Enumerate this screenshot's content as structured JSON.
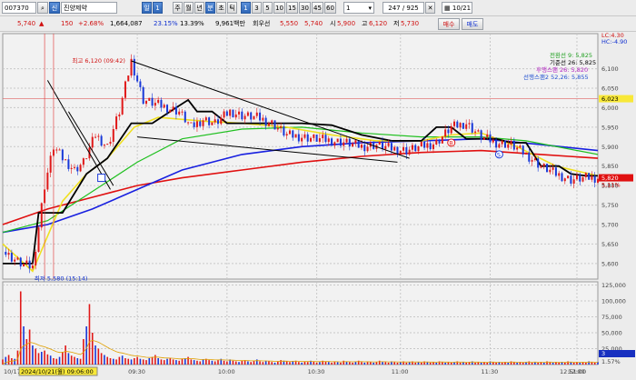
{
  "toolbar": {
    "code": "007370",
    "search_icon": "search-icon",
    "market_badge": "신",
    "stock_name": "진양제약",
    "period_buttons": [
      "일",
      "1"
    ],
    "period_units": [
      "주",
      "월",
      "년",
      "분",
      "초",
      "틱"
    ],
    "number_buttons": [
      "1",
      "3",
      "5",
      "10",
      "15",
      "30",
      "45",
      "60"
    ],
    "dropdown_value": "1",
    "page_counter": "247 / 925",
    "date_value": "10/21",
    "calendar_icon": "calendar-icon"
  },
  "quote": {
    "price": "5,740",
    "change_icon": "up-triangle-icon",
    "change": "150",
    "change_pct": "+2.68%",
    "volume": "1,664,087",
    "vol_ratio": "23.15%",
    "turnover": "13.39%",
    "amount": "9,961백만",
    "base_label": "회우선",
    "base_value": "5,550",
    "curr_value": "5,740",
    "open_label": "시",
    "open_value": "5,900",
    "high_label": "고",
    "high_value": "6,120",
    "low_label": "저",
    "low_value": "5,730",
    "buy_label": "매수",
    "sell_label": "매도"
  },
  "chart_data": {
    "type": "line",
    "session_label": "10/17",
    "x_date_label": "2024/10/21(월) 09:06:00",
    "x_ticks": [
      "09:30",
      "10:00",
      "10:30",
      "11:00",
      "11:30",
      "12:00",
      "12:30",
      "12:51:00"
    ],
    "price_ylim": [
      5560,
      6190
    ],
    "price_ticks": [
      "6,100",
      "6,050",
      "6,000",
      "5,950",
      "5,900",
      "5,850",
      "5,800",
      "5,750",
      "5,700",
      "5,650",
      "5,600"
    ],
    "price_top_labels": [
      "LC:4.30",
      "HC:-4.90"
    ],
    "current_price_tag": "5,820",
    "current_price": 5820,
    "sub_tag": "5,11%",
    "ref_price_tag": "6,023",
    "ref_price": 6023,
    "high_annotation": "최고 6,120 (09:42)",
    "low_annotation": "최저 5,580 (15:14)",
    "legend": [
      "전환선 9: 5,825",
      "기준선 26: 5,825",
      "후행스팬 26: 5,820",
      "선행스팬2 52,26: 5,855"
    ],
    "volume_ylim": [
      0,
      130000
    ],
    "volume_ticks": [
      "125,000",
      "100,000",
      "75,000",
      "50,000",
      "25,000",
      "3",
      "1.57%"
    ],
    "markers": [
      "B",
      "S"
    ],
    "series": [
      {
        "name": "price",
        "x": [
          0,
          6,
          10,
          14,
          17,
          20,
          24,
          27,
          31,
          35,
          39,
          43,
          47,
          51,
          55,
          59,
          63,
          67,
          71,
          76,
          80,
          85,
          90,
          95,
          100,
          105,
          110,
          115,
          120,
          125,
          130,
          135,
          140,
          145,
          150,
          155,
          160,
          165,
          170,
          175,
          180,
          185,
          190,
          195,
          199
        ],
        "values": [
          5630,
          5600,
          5590,
          5800,
          5900,
          5870,
          5840,
          5860,
          5930,
          5900,
          5990,
          6120,
          6020,
          6010,
          6000,
          5990,
          5950,
          5970,
          5960,
          5990,
          5980,
          5975,
          5960,
          5930,
          5925,
          5920,
          5915,
          5910,
          5900,
          5905,
          5895,
          5890,
          5900,
          5910,
          5950,
          5960,
          5925,
          5910,
          5905,
          5880,
          5850,
          5830,
          5815,
          5820,
          5820
        ]
      },
      {
        "name": "전환선",
        "x": [
          0,
          10,
          20,
          28,
          35,
          44,
          52,
          60,
          68,
          80,
          95,
          110,
          125,
          140,
          150,
          160,
          172,
          185,
          199
        ],
        "values": [
          5650,
          5580,
          5760,
          5830,
          5870,
          5950,
          5975,
          5970,
          5965,
          5960,
          5950,
          5930,
          5915,
          5915,
          5930,
          5935,
          5900,
          5850,
          5825
        ]
      },
      {
        "name": "기준선",
        "x": [
          0,
          10,
          12,
          20,
          28,
          35,
          43,
          50,
          58,
          62,
          65,
          70,
          75,
          80,
          90,
          100,
          110,
          120,
          130,
          140,
          145,
          150,
          155,
          160,
          165,
          170,
          175,
          180,
          186,
          190,
          195,
          199
        ],
        "values": [
          5600,
          5600,
          5730,
          5730,
          5830,
          5870,
          5960,
          5960,
          6000,
          6020,
          5990,
          5990,
          5960,
          5960,
          5960,
          5960,
          5955,
          5930,
          5915,
          5915,
          5950,
          5950,
          5920,
          5920,
          5920,
          5910,
          5910,
          5850,
          5850,
          5830,
          5825,
          5825
        ]
      },
      {
        "name": "후행스팬",
        "x": [
          0,
          15,
          25,
          35,
          45,
          60,
          80,
          100,
          120,
          140,
          160,
          175,
          199
        ],
        "values": [
          5680,
          5710,
          5760,
          5810,
          5860,
          5920,
          5945,
          5950,
          5935,
          5925,
          5925,
          5915,
          5880
        ]
      },
      {
        "name": "선행스팬2",
        "x": [
          0,
          15,
          30,
          45,
          60,
          80,
          100,
          120,
          140,
          160,
          180,
          199
        ],
        "values": [
          5680,
          5700,
          5740,
          5790,
          5840,
          5880,
          5900,
          5910,
          5915,
          5920,
          5905,
          5890
        ]
      },
      {
        "name": "선행스팬1",
        "x": [
          0,
          15,
          30,
          45,
          60,
          80,
          100,
          120,
          140,
          160,
          180,
          199
        ],
        "values": [
          5700,
          5740,
          5770,
          5800,
          5820,
          5840,
          5860,
          5875,
          5885,
          5890,
          5880,
          5870
        ]
      }
    ],
    "trendlines": [
      {
        "x": [
          43,
          136
        ],
        "values": [
          6120,
          5870
        ]
      },
      {
        "x": [
          45,
          132
        ],
        "values": [
          5925,
          5860
        ]
      },
      {
        "x": [
          15,
          36
        ],
        "values": [
          6070,
          5790
        ]
      },
      {
        "x": [
          22,
          37
        ],
        "values": [
          5990,
          5800
        ]
      }
    ],
    "volume": [
      8,
      12,
      15,
      10,
      9,
      22,
      115,
      60,
      40,
      55,
      30,
      25,
      18,
      20,
      22,
      16,
      14,
      10,
      9,
      12,
      20,
      30,
      18,
      14,
      12,
      10,
      9,
      40,
      60,
      95,
      50,
      30,
      25,
      18,
      15,
      12,
      10,
      9,
      8,
      12,
      14,
      10,
      9,
      8,
      10,
      12,
      9,
      8,
      7,
      10,
      12,
      15,
      10,
      8,
      7,
      9,
      10,
      8,
      7,
      6,
      9,
      10,
      12,
      8,
      7,
      6,
      5,
      8,
      9,
      7,
      6,
      5,
      7,
      9,
      6,
      5,
      8,
      6,
      5,
      4,
      6,
      7,
      5,
      4,
      6,
      8,
      5,
      4,
      6,
      5,
      4,
      3,
      5,
      7,
      6,
      5,
      4,
      5,
      6,
      4,
      3,
      5,
      4,
      6,
      5,
      3,
      4,
      6,
      5,
      4,
      3,
      5,
      4,
      3,
      6,
      5,
      4,
      3,
      5,
      6,
      4,
      3,
      5,
      4,
      3,
      4,
      6,
      5,
      4,
      3,
      5,
      4,
      3,
      4,
      5,
      3,
      4,
      5,
      3,
      4,
      3,
      5,
      4,
      3,
      4,
      3,
      5,
      4,
      3,
      4,
      3,
      4,
      5,
      3,
      4,
      3,
      4,
      5,
      3,
      4,
      3,
      4,
      3,
      5,
      4,
      3,
      4,
      3,
      4,
      3,
      5,
      4,
      3,
      4,
      3,
      4,
      5,
      3,
      4,
      3,
      4,
      3,
      5,
      4,
      3,
      4,
      3,
      4,
      3,
      5,
      4,
      3,
      4,
      3,
      4,
      3,
      5,
      4,
      3,
      4
    ]
  },
  "colors": {
    "up": "#e01818",
    "down": "#1838d8",
    "tenkan": "#f0e020",
    "kijun": "#000000",
    "chikou": "#20c020",
    "spanA": "#1820e0",
    "spanB": "#e01010",
    "grid": "#c8c8c8",
    "tag_red": "#e01010",
    "tag_yellow": "#f8e838",
    "tag_blue": "#1830c0"
  }
}
